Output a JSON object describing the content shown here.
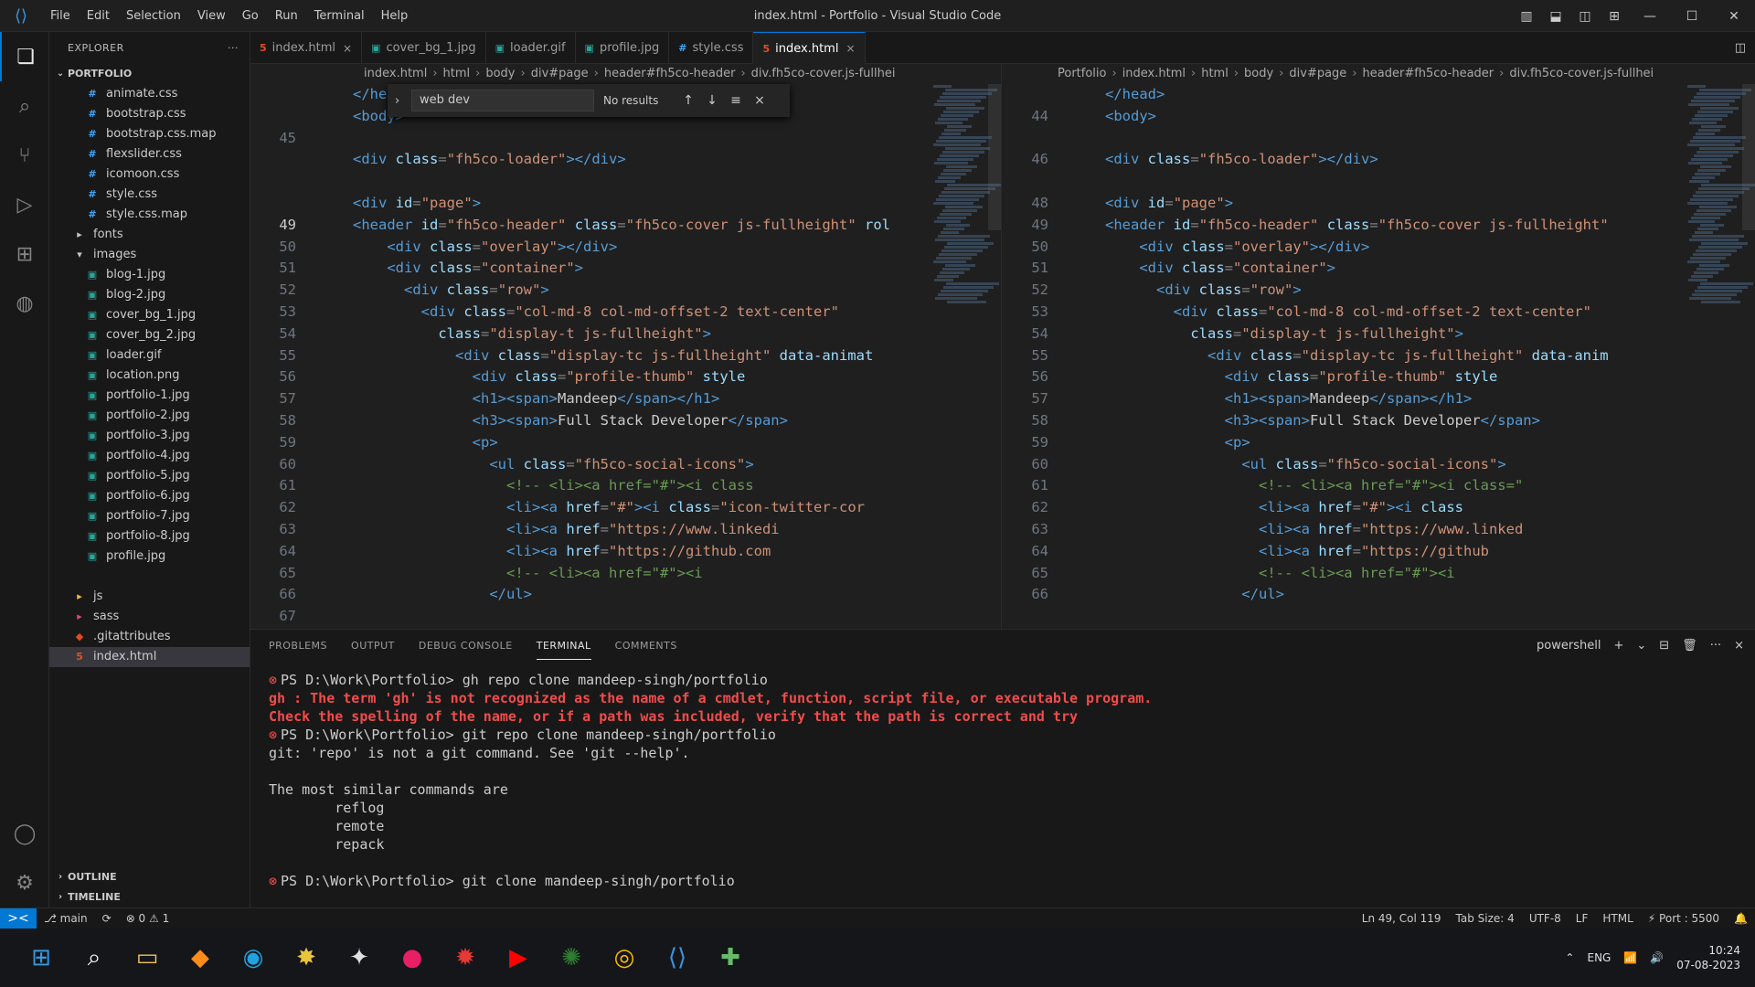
{
  "window": {
    "title": "index.html - Portfolio - Visual Studio Code",
    "menu": [
      "File",
      "Edit",
      "Selection",
      "View",
      "Go",
      "Run",
      "Terminal",
      "Help"
    ]
  },
  "sidebar": {
    "header": "EXPLORER",
    "more": "···",
    "root": "PORTFOLIO",
    "items": [
      {
        "label": "animate.css",
        "icon": "#",
        "color": "#42a5f5",
        "indent": 1
      },
      {
        "label": "bootstrap.css",
        "icon": "#",
        "color": "#42a5f5",
        "indent": 1
      },
      {
        "label": "bootstrap.css.map",
        "icon": "#",
        "color": "#42a5f5",
        "indent": 1
      },
      {
        "label": "flexslider.css",
        "icon": "#",
        "color": "#42a5f5",
        "indent": 1
      },
      {
        "label": "icomoon.css",
        "icon": "#",
        "color": "#42a5f5",
        "indent": 1
      },
      {
        "label": "style.css",
        "icon": "#",
        "color": "#42a5f5",
        "indent": 1
      },
      {
        "label": "style.css.map",
        "icon": "#",
        "color": "#42a5f5",
        "indent": 1
      },
      {
        "label": "fonts",
        "icon": "▸",
        "color": "#c5c5c5",
        "indent": 0
      },
      {
        "label": "images",
        "icon": "▾",
        "color": "#c5c5c5",
        "indent": 0
      },
      {
        "label": "blog-1.jpg",
        "icon": "▣",
        "color": "#26a69a",
        "indent": 1
      },
      {
        "label": "blog-2.jpg",
        "icon": "▣",
        "color": "#26a69a",
        "indent": 1
      },
      {
        "label": "cover_bg_1.jpg",
        "icon": "▣",
        "color": "#26a69a",
        "indent": 1
      },
      {
        "label": "cover_bg_2.jpg",
        "icon": "▣",
        "color": "#26a69a",
        "indent": 1
      },
      {
        "label": "loader.gif",
        "icon": "▣",
        "color": "#26a69a",
        "indent": 1
      },
      {
        "label": "location.png",
        "icon": "▣",
        "color": "#26a69a",
        "indent": 1
      },
      {
        "label": "portfolio-1.jpg",
        "icon": "▣",
        "color": "#26a69a",
        "indent": 1
      },
      {
        "label": "portfolio-2.jpg",
        "icon": "▣",
        "color": "#26a69a",
        "indent": 1
      },
      {
        "label": "portfolio-3.jpg",
        "icon": "▣",
        "color": "#26a69a",
        "indent": 1
      },
      {
        "label": "portfolio-4.jpg",
        "icon": "▣",
        "color": "#26a69a",
        "indent": 1
      },
      {
        "label": "portfolio-5.jpg",
        "icon": "▣",
        "color": "#26a69a",
        "indent": 1
      },
      {
        "label": "portfolio-6.jpg",
        "icon": "▣",
        "color": "#26a69a",
        "indent": 1
      },
      {
        "label": "portfolio-7.jpg",
        "icon": "▣",
        "color": "#26a69a",
        "indent": 1
      },
      {
        "label": "portfolio-8.jpg",
        "icon": "▣",
        "color": "#26a69a",
        "indent": 1
      },
      {
        "label": "profile.jpg",
        "icon": "▣",
        "color": "#26a69a",
        "indent": 1
      },
      {
        "label": "",
        "icon": "",
        "color": "#c5c5c5",
        "indent": 1
      },
      {
        "label": "js",
        "icon": "▸",
        "color": "#fbc02d",
        "indent": 0
      },
      {
        "label": "sass",
        "icon": "▸",
        "color": "#ec407a",
        "indent": 0
      },
      {
        "label": ".gitattributes",
        "icon": "◆",
        "color": "#e64a19",
        "indent": 0
      },
      {
        "label": "index.html",
        "icon": "5",
        "color": "#e44d26",
        "indent": 0,
        "selected": true
      }
    ],
    "outline": "OUTLINE",
    "timeline": "TIMELINE"
  },
  "tabs": [
    {
      "label": "index.html",
      "icon": "5",
      "color": "#e44d26",
      "close": "×"
    },
    {
      "label": "cover_bg_1.jpg",
      "icon": "▣",
      "color": "#26a69a",
      "close": ""
    },
    {
      "label": "loader.gif",
      "icon": "▣",
      "color": "#26a69a",
      "close": ""
    },
    {
      "label": "profile.jpg",
      "icon": "▣",
      "color": "#26a69a",
      "close": ""
    },
    {
      "label": "style.css",
      "icon": "#",
      "color": "#42a5f5",
      "close": ""
    },
    {
      "label": "index.html",
      "icon": "5",
      "color": "#e44d26",
      "close": "×",
      "active": true
    }
  ],
  "left_pane": {
    "breadcrumb": [
      "index.html",
      "html",
      "body",
      "div#page",
      "header#fh5co-header",
      "div.fh5co-cover.js-fullhei"
    ],
    "find": {
      "value": "web dev",
      "count": "No results",
      "up": "↑",
      "down": "↓",
      "menu": "≡"
    },
    "lines": [
      {
        "n": "",
        "html": "<span class='t-tag'>&lt;/head&gt;</span>"
      },
      {
        "n": "",
        "html": "<span class='t-tag'>&lt;body&gt;</span>"
      },
      {
        "n": "45",
        "html": ""
      },
      {
        "n": "",
        "html": "<span class='t-tag'>&lt;div</span> <span class='t-attr'>class</span>=<span class='t-str'>\"fh5co-loader\"</span><span class='t-tag'>&gt;&lt;/div&gt;</span>"
      },
      {
        "n": "",
        "html": ""
      },
      {
        "n": "",
        "html": "<span class='t-tag'>&lt;div</span> <span class='t-attr'>id</span>=<span class='t-str'>\"page\"</span><span class='t-tag'>&gt;</span>"
      },
      {
        "n": "49",
        "html": "<span class='t-tag'>&lt;header</span> <span class='t-attr'>id</span>=<span class='t-str'>\"fh5co-header\"</span> <span class='t-attr'>class</span>=<span class='t-str'>\"fh5co-cover js-fullheight\"</span> <span class='t-attr'>rol</span>",
        "cur": true
      },
      {
        "n": "50",
        "html": "    <span class='t-tag'>&lt;div</span> <span class='t-attr'>class</span>=<span class='t-str'>\"overlay\"</span><span class='t-tag'>&gt;&lt;/div&gt;</span>"
      },
      {
        "n": "51",
        "html": "    <span class='t-tag'>&lt;div</span> <span class='t-attr'>class</span>=<span class='t-str'>\"container\"</span><span class='t-tag'>&gt;</span>"
      },
      {
        "n": "52",
        "html": "      <span class='t-tag'>&lt;div</span> <span class='t-attr'>class</span>=<span class='t-str'>\"row\"</span><span class='t-tag'>&gt;</span>"
      },
      {
        "n": "53",
        "html": "        <span class='t-tag'>&lt;div</span> <span class='t-attr'>class</span>=<span class='t-str'>\"col-md-8 col-md-offset-2 text-center\"</span>"
      },
      {
        "n": "54",
        "html": "          <span class='t-attr'>class</span>=<span class='t-str'>\"display-t js-fullheight\"</span><span class='t-tag'>&gt;</span>"
      },
      {
        "n": "55",
        "html": "            <span class='t-tag'>&lt;div</span> <span class='t-attr'>class</span>=<span class='t-str'>\"display-tc js-fullheight\"</span> <span class='t-attr'>data-animat</span>"
      },
      {
        "n": "56",
        "html": "              <span class='t-tag'>&lt;div</span> <span class='t-attr'>class</span>=<span class='t-str'>\"profile-thumb\"</span> <span class='t-attr'>style</span>"
      },
      {
        "n": "57",
        "html": "              <span class='t-tag'>&lt;h1&gt;&lt;span&gt;</span><span class='t-text'>Mandeep</span><span class='t-tag'>&lt;/span&gt;&lt;/h1&gt;</span>"
      },
      {
        "n": "58",
        "html": "              <span class='t-tag'>&lt;h3&gt;&lt;span&gt;</span><span class='t-text'>Full Stack Developer</span><span class='t-tag'>&lt;/span&gt;</span>"
      },
      {
        "n": "59",
        "html": "              <span class='t-tag'>&lt;p&gt;</span>"
      },
      {
        "n": "60",
        "html": "                <span class='t-tag'>&lt;ul</span> <span class='t-attr'>class</span>=<span class='t-str'>\"fh5co-social-icons\"</span><span class='t-tag'>&gt;</span>"
      },
      {
        "n": "61",
        "html": "                  <span class='t-com'>&lt;!-- &lt;li&gt;&lt;a href=\"#\"&gt;&lt;i class</span>"
      },
      {
        "n": "62",
        "html": "                  <span class='t-tag'>&lt;li&gt;&lt;a</span> <span class='t-attr'>href</span>=<span class='t-str'>\"#\"</span><span class='t-tag'>&gt;&lt;i</span> <span class='t-attr'>class</span>=<span class='t-str'>\"icon-twitter-cor</span>"
      },
      {
        "n": "63",
        "html": "                  <span class='t-tag'>&lt;li&gt;&lt;a</span> <span class='t-attr'>href</span>=<span class='t-str'>\"https://www.linkedi</span>"
      },
      {
        "n": "64",
        "html": "                  <span class='t-tag'>&lt;li&gt;&lt;a</span> <span class='t-attr'>href</span>=<span class='t-str'>\"https://github.com</span>"
      },
      {
        "n": "65",
        "html": "                  <span class='t-com'>&lt;!-- &lt;li&gt;&lt;a href=\"#\"&gt;&lt;i</span>"
      },
      {
        "n": "66",
        "html": "                <span class='t-tag'>&lt;/ul&gt;</span>"
      },
      {
        "n": "67",
        "html": ""
      }
    ]
  },
  "right_pane": {
    "breadcrumb": [
      "Portfolio",
      "index.html",
      "html",
      "body",
      "div#page",
      "header#fh5co-header",
      "div.fh5co-cover.js-fullhei"
    ],
    "lines": [
      {
        "n": "",
        "html": "<span class='t-tag'>&lt;/head&gt;</span>"
      },
      {
        "n": "44",
        "html": "<span class='t-tag'>&lt;body&gt;</span>"
      },
      {
        "n": "",
        "html": ""
      },
      {
        "n": "46",
        "html": "<span class='t-tag'>&lt;div</span> <span class='t-attr'>class</span>=<span class='t-str'>\"fh5co-loader\"</span><span class='t-tag'>&gt;&lt;/div&gt;</span>"
      },
      {
        "n": "",
        "html": ""
      },
      {
        "n": "48",
        "html": "<span class='t-tag'>&lt;div</span> <span class='t-attr'>id</span>=<span class='t-str'>\"page\"</span><span class='t-tag'>&gt;</span>"
      },
      {
        "n": "49",
        "html": "<span class='t-tag'>&lt;header</span> <span class='t-attr'>id</span>=<span class='t-str'>\"fh5co-header\"</span> <span class='t-attr'>class</span>=<span class='t-str'>\"fh5co-cover js-fullheight\"</span>"
      },
      {
        "n": "50",
        "html": "    <span class='t-tag'>&lt;div</span> <span class='t-attr'>class</span>=<span class='t-str'>\"overlay\"</span><span class='t-tag'>&gt;&lt;/div&gt;</span>"
      },
      {
        "n": "51",
        "html": "    <span class='t-tag'>&lt;div</span> <span class='t-attr'>class</span>=<span class='t-str'>\"container\"</span><span class='t-tag'>&gt;</span>"
      },
      {
        "n": "52",
        "html": "      <span class='t-tag'>&lt;div</span> <span class='t-attr'>class</span>=<span class='t-str'>\"row\"</span><span class='t-tag'>&gt;</span>"
      },
      {
        "n": "53",
        "html": "        <span class='t-tag'>&lt;div</span> <span class='t-attr'>class</span>=<span class='t-str'>\"col-md-8 col-md-offset-2 text-center\"</span>"
      },
      {
        "n": "54",
        "html": "          <span class='t-attr'>class</span>=<span class='t-str'>\"display-t js-fullheight\"</span><span class='t-tag'>&gt;</span>"
      },
      {
        "n": "55",
        "html": "            <span class='t-tag'>&lt;div</span> <span class='t-attr'>class</span>=<span class='t-str'>\"display-tc js-fullheight\"</span> <span class='t-attr'>data-anim</span>"
      },
      {
        "n": "56",
        "html": "              <span class='t-tag'>&lt;div</span> <span class='t-attr'>class</span>=<span class='t-str'>\"profile-thumb\"</span> <span class='t-attr'>style</span>"
      },
      {
        "n": "57",
        "html": "              <span class='t-tag'>&lt;h1&gt;&lt;span&gt;</span><span class='t-text'>Mandeep</span><span class='t-tag'>&lt;/span&gt;&lt;/h1&gt;</span>"
      },
      {
        "n": "58",
        "html": "              <span class='t-tag'>&lt;h3&gt;&lt;span&gt;</span><span class='t-text'>Full Stack Developer</span><span class='t-tag'>&lt;/span&gt;</span>"
      },
      {
        "n": "59",
        "html": "              <span class='t-tag'>&lt;p&gt;</span>"
      },
      {
        "n": "60",
        "html": "                <span class='t-tag'>&lt;ul</span> <span class='t-attr'>class</span>=<span class='t-str'>\"fh5co-social-icons\"</span><span class='t-tag'>&gt;</span>"
      },
      {
        "n": "61",
        "html": "                  <span class='t-com'>&lt;!-- &lt;li&gt;&lt;a href=\"#\"&gt;&lt;i class=\"</span>"
      },
      {
        "n": "62",
        "html": "                  <span class='t-tag'>&lt;li&gt;&lt;a</span> <span class='t-attr'>href</span>=<span class='t-str'>\"#\"</span><span class='t-tag'>&gt;&lt;i</span> <span class='t-attr'>class</span>"
      },
      {
        "n": "63",
        "html": "                  <span class='t-tag'>&lt;li&gt;&lt;a</span> <span class='t-attr'>href</span>=<span class='t-str'>\"https://www.linked</span>"
      },
      {
        "n": "64",
        "html": "                  <span class='t-tag'>&lt;li&gt;&lt;a</span> <span class='t-attr'>href</span>=<span class='t-str'>\"https://github</span>"
      },
      {
        "n": "65",
        "html": "                  <span class='t-com'>&lt;!-- &lt;li&gt;&lt;a href=\"#\"&gt;&lt;i</span>"
      },
      {
        "n": "66",
        "html": "                <span class='t-tag'>&lt;/ul&gt;</span>"
      }
    ]
  },
  "panel": {
    "tabs": [
      "PROBLEMS",
      "OUTPUT",
      "DEBUG CONSOLE",
      "TERMINAL",
      "COMMENTS"
    ],
    "active_tab": "TERMINAL",
    "actions": [
      "powershell",
      "+",
      "⌄",
      "⊟",
      "🗑",
      "···",
      "×"
    ],
    "terminal_lines": [
      {
        "type": "prompt",
        "text": "PS D:\\Work\\Portfolio> gh repo clone mandeep-singh/portfolio"
      },
      {
        "type": "err",
        "text": "gh : The term 'gh' is not recognized as the name of a cmdlet, function, script file, or executable program."
      },
      {
        "type": "err",
        "text": "Check the spelling of the name, or if a path was included, verify that the path is correct and try"
      },
      {
        "type": "prompt",
        "text": "PS D:\\Work\\Portfolio> git repo clone mandeep-singh/portfolio"
      },
      {
        "type": "plain",
        "text": "git: 'repo' is not a git command. See 'git --help'."
      },
      {
        "type": "plain",
        "text": ""
      },
      {
        "type": "plain",
        "text": "The most similar commands are"
      },
      {
        "type": "plain",
        "text": "        reflog"
      },
      {
        "type": "plain",
        "text": "        remote"
      },
      {
        "type": "plain",
        "text": "        repack"
      },
      {
        "type": "plain",
        "text": ""
      },
      {
        "type": "prompt",
        "text": "PS D:\\Work\\Portfolio> git clone mandeep-singh/portfolio"
      }
    ]
  },
  "status": {
    "remote": "><",
    "left": [
      "⎇ main",
      "⟳",
      "⊗ 0  ⚠ 1"
    ],
    "right": [
      "Ln 49, Col 119",
      "Tab Size: 4",
      "UTF-8",
      "LF",
      "HTML",
      "⚡ Port : 5500",
      "🔔"
    ]
  },
  "taskbar": {
    "apps": [
      {
        "name": "windows-start",
        "glyph": "⊞",
        "color": "#3a96dd"
      },
      {
        "name": "search",
        "glyph": "⌕",
        "color": "#ffffff"
      },
      {
        "name": "file-explorer",
        "glyph": "▭",
        "color": "#f0c060"
      },
      {
        "name": "app-orange",
        "glyph": "◆",
        "color": "#ff8c1a"
      },
      {
        "name": "edge",
        "glyph": "◉",
        "color": "#1fa3e0"
      },
      {
        "name": "app-yellow",
        "glyph": "✸",
        "color": "#e8c53a"
      },
      {
        "name": "app-white",
        "glyph": "✦",
        "color": "#e0e0e0"
      },
      {
        "name": "app-pink",
        "glyph": "●",
        "color": "#e91e63"
      },
      {
        "name": "app-red",
        "glyph": "✹",
        "color": "#e53935"
      },
      {
        "name": "youtube",
        "glyph": "▶",
        "color": "#ff0000"
      },
      {
        "name": "app-green",
        "glyph": "✺",
        "color": "#2e7d32"
      },
      {
        "name": "chrome",
        "glyph": "◎",
        "color": "#fbbc05"
      },
      {
        "name": "vscode",
        "glyph": "⟨⟩",
        "color": "#3a96dd"
      },
      {
        "name": "app-lime",
        "glyph": "✚",
        "color": "#66bb6a"
      }
    ],
    "tray": [
      "⌃",
      "ENG",
      "📶",
      "🔊"
    ],
    "time": "10:24",
    "date": "07-08-2023"
  }
}
